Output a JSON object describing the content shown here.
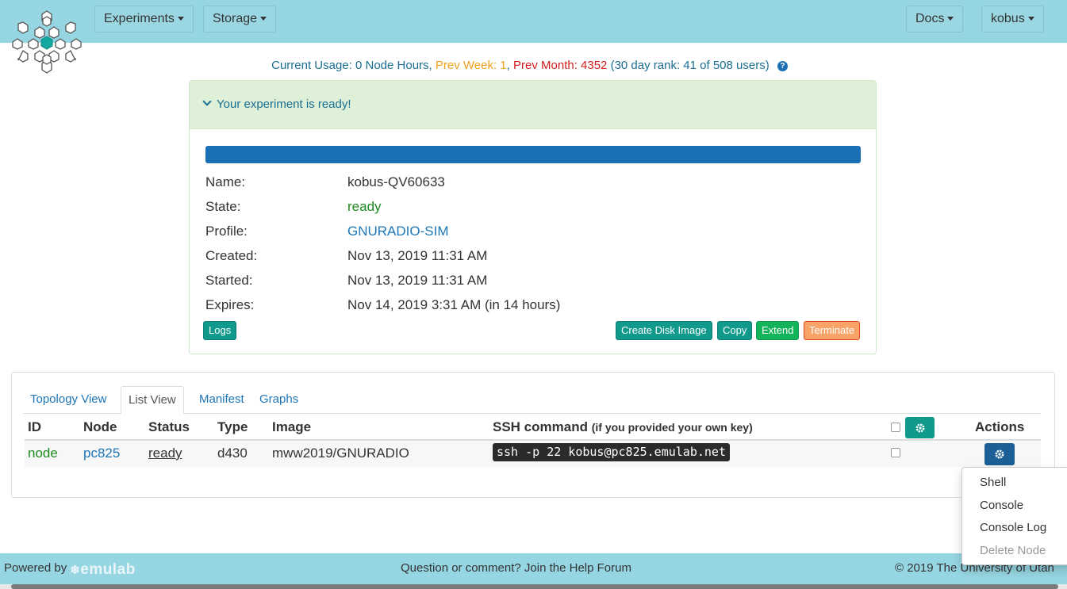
{
  "nav": {
    "experiments": "Experiments",
    "storage": "Storage",
    "docs": "Docs",
    "user": "kobus"
  },
  "usage": {
    "current": "Current Usage: 0 Node Hours",
    "sep1": ",",
    "prev_week": "Prev Week: 1",
    "sep2": ",",
    "prev_month": "Prev Month: 4352",
    "rank": "(30 day rank: 41 of 508 users)",
    "help_glyph": "?"
  },
  "experiment": {
    "status_message": "Your experiment is ready!",
    "progress_percent": 100,
    "fields": {
      "name_label": "Name:",
      "name": "kobus-QV60633",
      "state_label": "State:",
      "state": "ready",
      "profile_label": "Profile:",
      "profile": "GNURADIO-SIM",
      "created_label": "Created:",
      "created": "Nov 13, 2019 11:31 AM",
      "started_label": "Started:",
      "started": "Nov 13, 2019 11:31 AM",
      "expires_label": "Expires:",
      "expires": "Nov 14, 2019 3:31 AM (in 14 hours)"
    },
    "buttons": {
      "logs": "Logs",
      "create_disk_image": "Create Disk Image",
      "copy": "Copy",
      "extend": "Extend",
      "terminate": "Terminate"
    }
  },
  "tabs": [
    "Topology View",
    "List View",
    "Manifest",
    "Graphs"
  ],
  "active_tab": "List View",
  "table": {
    "headers": {
      "id": "ID",
      "node": "Node",
      "status": "Status",
      "type": "Type",
      "image": "Image",
      "ssh": "SSH command",
      "ssh_note": "(if you provided your own key)",
      "actions": "Actions"
    },
    "rows": [
      {
        "id": "node",
        "node": "pc825",
        "status": "ready",
        "type": "d430",
        "image": "mww2019/GNURADIO",
        "ssh": "ssh -p 22 kobus@pc825.emulab.net"
      }
    ]
  },
  "actions_menu": [
    "Shell",
    "Console",
    "Console Log",
    "Delete Node"
  ],
  "footer": {
    "powered_by": "Powered by",
    "logo_text": "emulab",
    "help": "Question or comment? Join the Help Forum",
    "copyright": "© 2019 The University of Utah"
  },
  "colors": {
    "header_bg": "#96d5e2",
    "success_bg": "#dff0d8",
    "progress": "#1b6fb5",
    "teal_button": "#119a8c",
    "green_button": "#13b35c",
    "orange_button": "#f8a468",
    "link": "#1d76b8",
    "ready_text": "#1d8a20"
  }
}
